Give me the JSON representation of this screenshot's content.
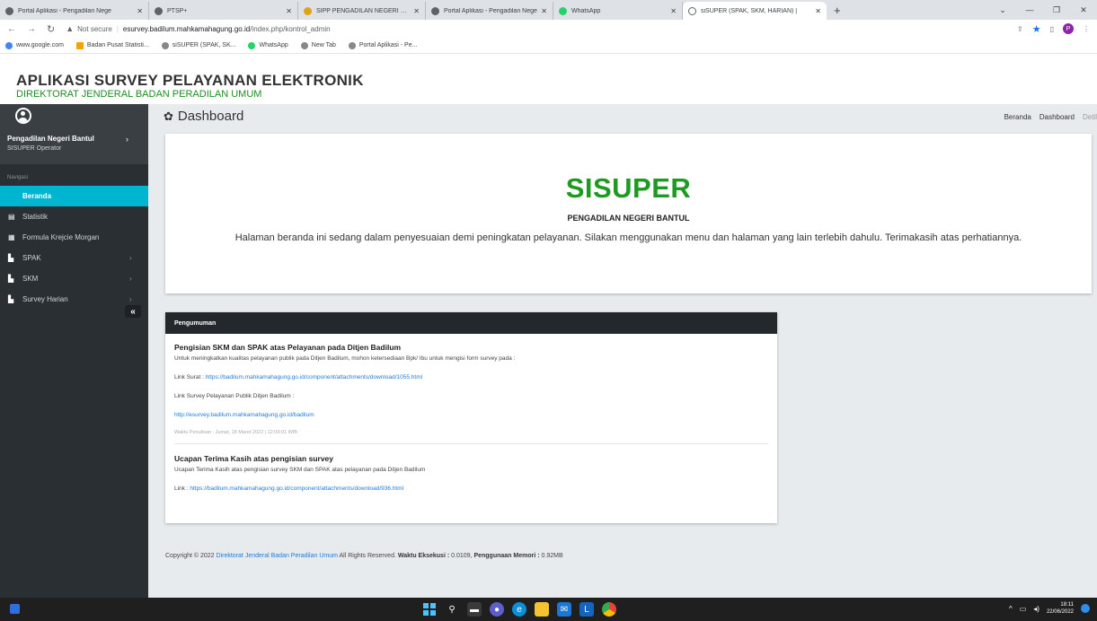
{
  "browser": {
    "tabs": [
      {
        "title": "Portal Aplikasi - Pengadilan Nege",
        "icon": "globe-icon"
      },
      {
        "title": "PTSP+",
        "icon": "globe-icon"
      },
      {
        "title": "SIPP PENGADILAN NEGERI BANT",
        "icon": "sipp-icon"
      },
      {
        "title": "Portal Aplikasi - Pengadilan Nege",
        "icon": "globe-icon"
      },
      {
        "title": "WhatsApp",
        "icon": "whatsapp-icon"
      },
      {
        "title": "siSUPER (SPAK, SKM, HARIAN) | ",
        "icon": "sisuper-icon"
      }
    ],
    "active_tab_index": 5,
    "address": {
      "security": "Not secure",
      "host": "esurvey.badilum.mahkamahagung.go.id",
      "path": "/index.php/kontrol_admin"
    },
    "bookmarks": [
      {
        "label": "www.google.com",
        "icon": "google-icon"
      },
      {
        "label": "Badan Pusat Statisti...",
        "icon": "bps-icon"
      },
      {
        "label": "siSUPER (SPAK, SK...",
        "icon": "sisuper-icon"
      },
      {
        "label": "WhatsApp",
        "icon": "whatsapp-icon"
      },
      {
        "label": "New Tab",
        "icon": "globe-icon"
      },
      {
        "label": "Portal Aplikasi - Pe...",
        "icon": "globe-icon"
      }
    ],
    "profile_initial": "P"
  },
  "app": {
    "title": "APLIKASI SURVEY PELAYANAN ELEKTRONIK",
    "subtitle": "DIREKTORAT JENDERAL BADAN PERADILAN UMUM"
  },
  "sidebar": {
    "user_name": "Pengadilan Negeri Bantul",
    "user_role": "SISUPER Operator",
    "nav_heading": "Navigasi",
    "items": [
      {
        "label": "Beranda",
        "icon": "home-icon",
        "active": true,
        "has_caret": false
      },
      {
        "label": "Statistik",
        "icon": "chart-icon",
        "active": false,
        "has_caret": false
      },
      {
        "label": "Formula Krejcie Morgan",
        "icon": "calculator-icon",
        "active": false,
        "has_caret": false
      },
      {
        "label": "SPAK",
        "icon": "document-icon",
        "active": false,
        "has_caret": true
      },
      {
        "label": "SKM",
        "icon": "document-icon",
        "active": false,
        "has_caret": true
      },
      {
        "label": "Survey Harian",
        "icon": "document-icon",
        "active": false,
        "has_caret": true
      }
    ],
    "collapse_label": "«"
  },
  "main": {
    "page_title": "Dashboard",
    "breadcrumb": [
      "Beranda",
      "Dashboard",
      "Detil"
    ],
    "hero": {
      "title": "SISUPER",
      "subtitle": "PENGADILAN NEGERI BANTUL",
      "text": "Halaman beranda ini sedang dalam penyesuaian demi peningkatan pelayanan. Silakan menggunakan menu dan halaman yang lain terlebih dahulu. Terimakasih atas perhatiannya."
    },
    "announcement": {
      "header": "Pengumuman",
      "items": [
        {
          "title": "Pengisian SKM dan SPAK atas Pelayanan pada Ditjen Badilum",
          "body": "Untuk meningkatkan kualitas pelayanan publik pada Ditjen Badilum,  mohon ketersediaan Bpk/ Ibu untuk mengisi form survey pada :",
          "link1_label": "Link Surat : ",
          "link1_url": "https://badilum.mahkamahagung.go.id/component/attachments/download/1055.html",
          "link2_label": "Link Survey Pelayanan Publik Ditjen Badilum :",
          "link2_url": "http://esurvey.badilum.mahkamahagung.go.id/badilum",
          "timestamp": "Waktu Penulisan : Jumat, 18 Maret 2022 | 12:09:01 WIB"
        },
        {
          "title": "Ucapan Terima Kasih atas pengisian survey",
          "body": "Ucapan Terima Kasih atas pengisian survey SKM dan SPAK atas pelayanan pada Ditjen Badilum",
          "link_label": "Link : ",
          "link_url": "https://badilum.mahkamahagung.go.id/component/attachments/download/936.html"
        }
      ]
    },
    "footer": {
      "prefix": "Copyright © 2022 ",
      "org": "Direktorat Jenderal Badan Peradilan Umum",
      "rights": " All Rights Reserved. ",
      "exec_label": "Waktu Eksekusi :",
      "exec_value": " 0.0109, ",
      "mem_label": "Penggunaan Memori :",
      "mem_value": " 0.92MB"
    }
  },
  "taskbar": {
    "time": "18:11",
    "date": "22/06/2022",
    "apps": [
      "start-icon",
      "search-icon",
      "taskview-icon",
      "chat-icon",
      "edge-icon",
      "file-explorer-icon",
      "mail-icon",
      "app-l-icon",
      "chrome-icon"
    ]
  },
  "colors": {
    "brand_green": "#1e9a23",
    "sidebar_bg": "#2a2f34",
    "active_nav": "#00b5d0",
    "link": "#1f7bd6"
  }
}
